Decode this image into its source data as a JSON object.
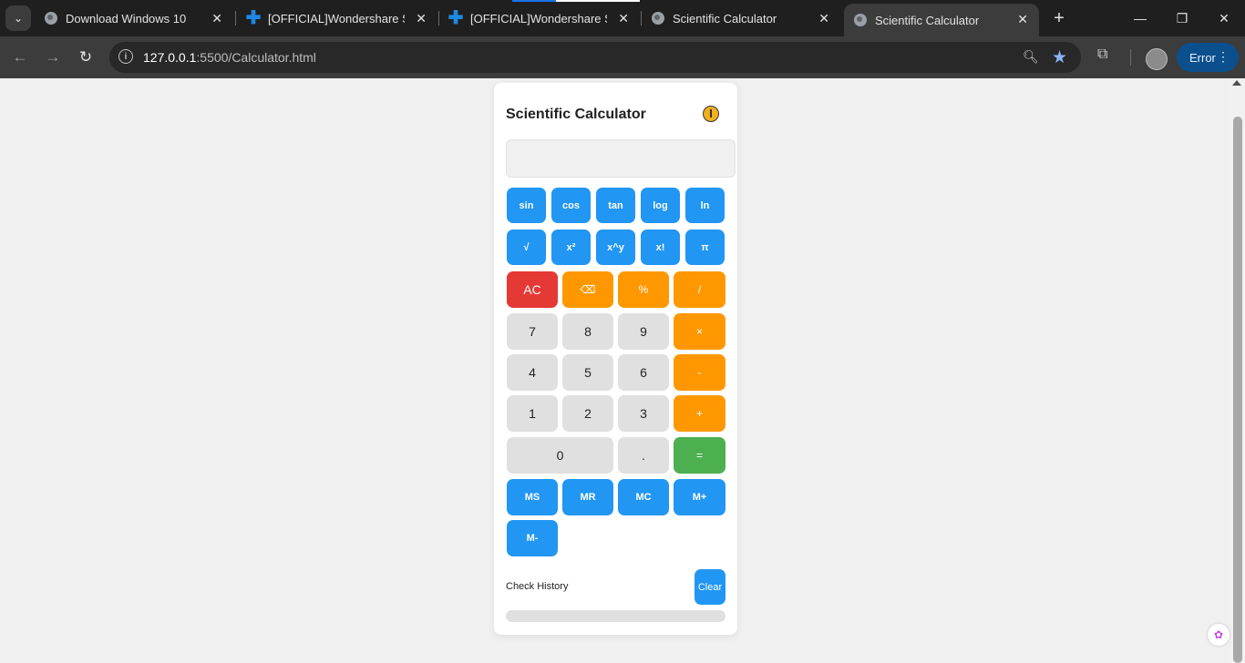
{
  "browser": {
    "tabs": [
      {
        "title": "Download Windows 10",
        "icon": "globe-icon"
      },
      {
        "title": "[OFFICIAL]Wondershare Soft",
        "icon": "wondershare-icon"
      },
      {
        "title": "[OFFICIAL]Wondershare Soft",
        "icon": "wondershare-icon"
      },
      {
        "title": "Scientific Calculator",
        "icon": "globe-icon"
      },
      {
        "title": "Scientific Calculator",
        "icon": "globe-icon",
        "active": true
      }
    ],
    "url_host": "127.0.0.1",
    "url_path": ":5500/Calculator.html",
    "error_label": "Error"
  },
  "calculator": {
    "title": "Scientific Calculator",
    "display_value": "",
    "sci_row1": [
      "sin",
      "cos",
      "tan",
      "log",
      "ln"
    ],
    "sci_row2": [
      "√",
      "x²",
      "x^y",
      "x!",
      "π"
    ],
    "row_ops": [
      "AC",
      "⌫",
      "%",
      "/"
    ],
    "row_789": [
      "7",
      "8",
      "9",
      "×"
    ],
    "row_456": [
      "4",
      "5",
      "6",
      "-"
    ],
    "row_123": [
      "1",
      "2",
      "3",
      "+"
    ],
    "row_0": [
      "0",
      ".",
      "="
    ],
    "memory": [
      "MS",
      "MR",
      "MC",
      "M+",
      "M-"
    ],
    "history_label": "Check History",
    "clear_label": "Clear"
  },
  "colors": {
    "blue": "#2196f3",
    "orange": "#ff9800",
    "red": "#e53935",
    "gray": "#e0e0e0",
    "green": "#4caf50"
  }
}
